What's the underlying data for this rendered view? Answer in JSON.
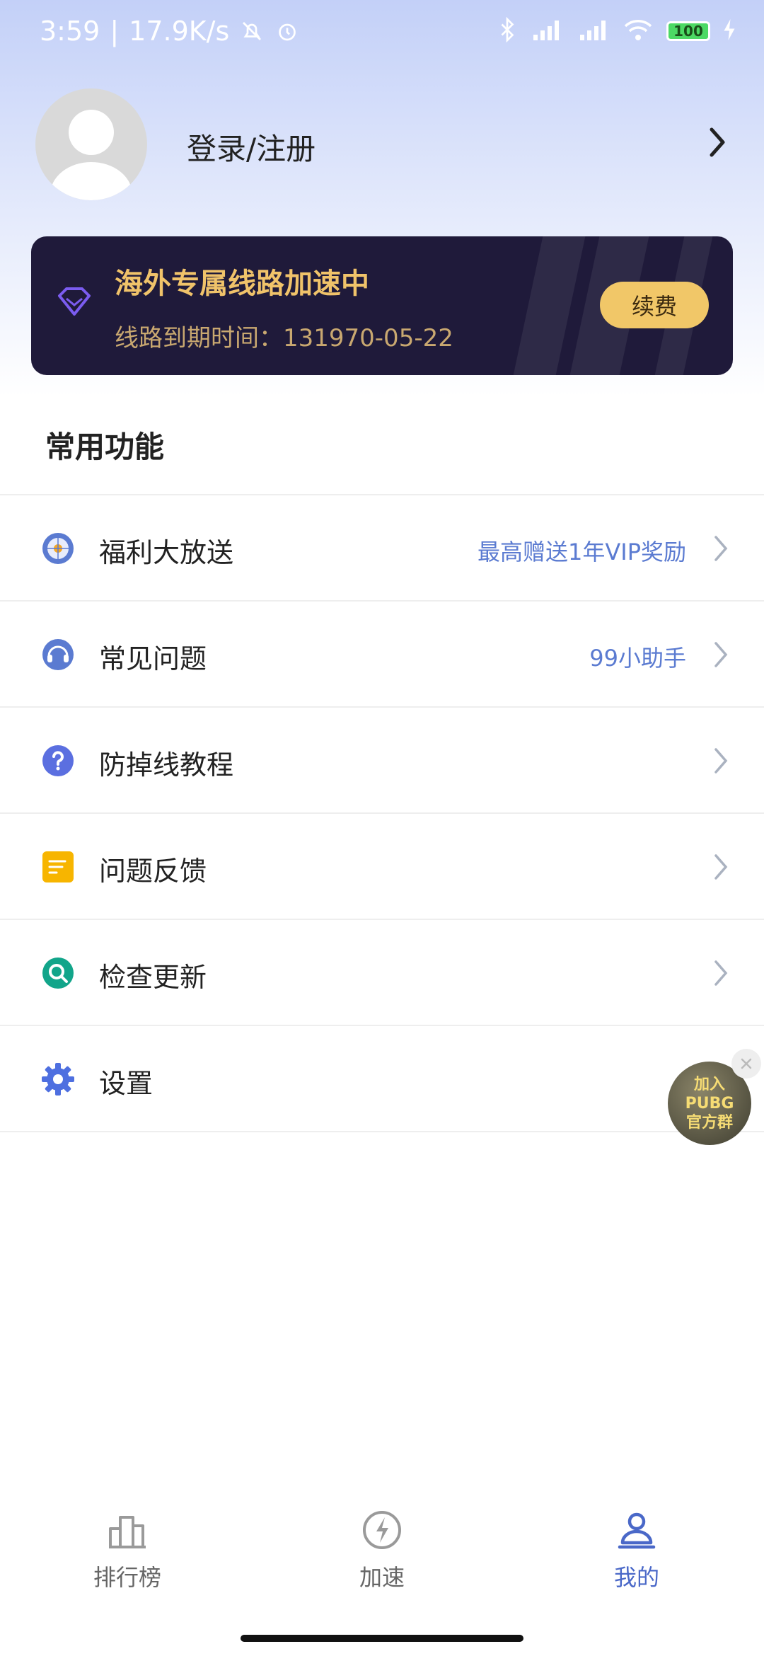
{
  "status_bar": {
    "time": "3:59",
    "speed": "17.9K/s",
    "battery": "100"
  },
  "profile": {
    "login_label": "登录/注册"
  },
  "vip_card": {
    "title": "海外专属线路加速中",
    "expire_text": "线路到期时间：131970-05-22",
    "renew_label": "续费"
  },
  "section": {
    "title": "常用功能"
  },
  "menu": {
    "items": [
      {
        "label": "福利大放送",
        "extra": "最高赠送1年VIP奖励",
        "icon": "gift-wheel-icon"
      },
      {
        "label": "常见问题",
        "extra": "99小助手",
        "icon": "headset-icon"
      },
      {
        "label": "防掉线教程",
        "extra": "",
        "icon": "question-icon"
      },
      {
        "label": "问题反馈",
        "extra": "",
        "icon": "note-icon"
      },
      {
        "label": "检查更新",
        "extra": "",
        "icon": "search-update-icon"
      },
      {
        "label": "设置",
        "extra": "",
        "icon": "gear-icon"
      }
    ]
  },
  "floating_badge": {
    "line1": "加入",
    "line2": "PUBG",
    "line3": "官方群"
  },
  "bottom_nav": {
    "items": [
      {
        "label": "排行榜",
        "icon": "ranking-icon"
      },
      {
        "label": "加速",
        "icon": "boost-icon"
      },
      {
        "label": "我的",
        "icon": "profile-icon"
      }
    ]
  },
  "colors": {
    "accent": "#5b7bd1",
    "vip_bg": "#1f1a3a",
    "vip_gold": "#f0c36a",
    "nav_active": "#4a68c8",
    "nav_inactive": "#9a9a9a"
  }
}
